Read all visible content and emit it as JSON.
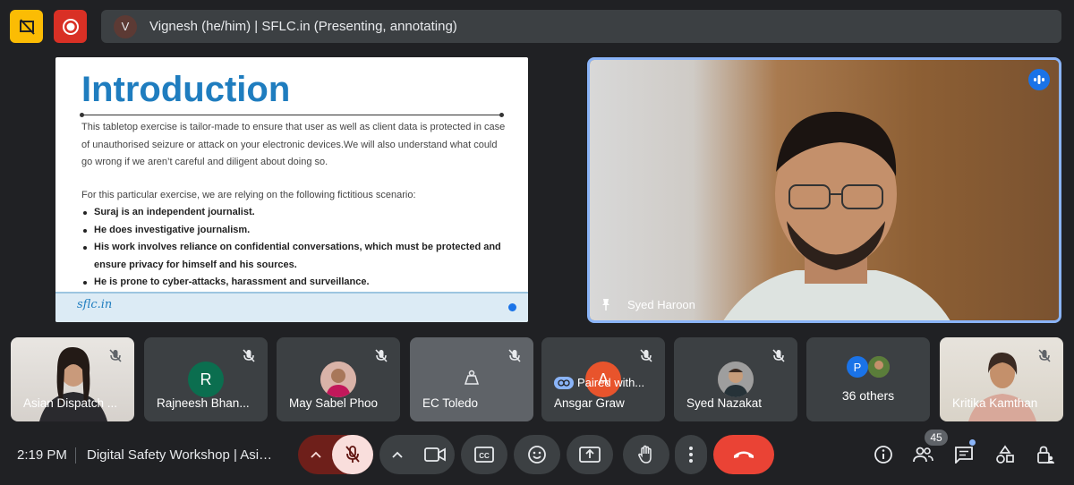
{
  "topbar": {
    "presenter_initial": "V",
    "presenting_text": "Vignesh (he/him) | SFLC.in (Presenting, annotating)"
  },
  "slide": {
    "title": "Introduction",
    "intro": "This tabletop exercise is tailor-made to ensure that user as well as client data is protected in case of unauthorised seizure or attack on your electronic devices.We will also understand what could go wrong if we aren’t careful and diligent about doing so.",
    "scenario_intro": "For this particular exercise, we are relying on the following fictitious scenario:",
    "bullets": [
      "Suraj is an independent journalist.",
      "He does investigative journalism.",
      "His work involves reliance on confidential conversations, which must be protected and ensure privacy for himself and his sources.",
      "He is prone to cyber-attacks, harassment and surveillance."
    ],
    "logo": "sflc.in"
  },
  "speaker": {
    "name": "Syed Haroon"
  },
  "tiles": [
    {
      "label": "Asian Dispatch ..."
    },
    {
      "label": "Rajneesh Bhan...",
      "initial": "R",
      "color": "#0b6e4f"
    },
    {
      "label": "May Sabel Phoo"
    },
    {
      "label": "EC Toledo"
    },
    {
      "label": "Ansgar Graw",
      "initial": "A",
      "color": "#e8542c",
      "overlay": "Paired with..."
    },
    {
      "label": "Syed Nazakat"
    },
    {
      "label": "36 others",
      "initial": "P",
      "color": "#1a73e8"
    },
    {
      "label": "Kritika Kamthan"
    }
  ],
  "bottombar": {
    "time": "2:19 PM",
    "meeting_title": "Digital Safety Workshop | Asian Dispatch",
    "participant_count": "45"
  },
  "colors": {
    "background": "#202124",
    "accent": "#8ab4f8",
    "end_call": "#ea4335",
    "slide_title": "#1f7dbf"
  }
}
